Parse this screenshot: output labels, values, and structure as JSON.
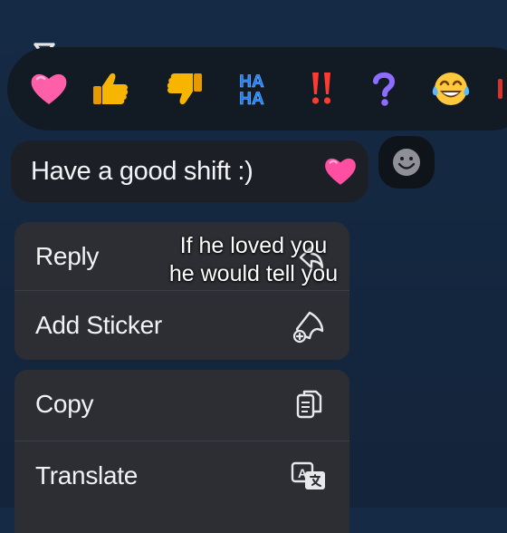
{
  "reactions": [
    {
      "name": "heart",
      "label": ""
    },
    {
      "name": "thumbs-up",
      "label": ""
    },
    {
      "name": "thumbs-down",
      "label": ""
    },
    {
      "name": "haha",
      "label": "HA HA"
    },
    {
      "name": "exclamation",
      "label": "!!"
    },
    {
      "name": "question",
      "label": "?"
    },
    {
      "name": "tears-of-joy",
      "label": ""
    }
  ],
  "message": {
    "text": "Have a good shift :)",
    "emoji": "heart"
  },
  "menu": {
    "reply": "Reply",
    "add_sticker": "Add Sticker",
    "copy": "Copy",
    "translate": "Translate"
  },
  "caption": {
    "line1": "If he loved you",
    "line2": "he would tell you"
  },
  "colors": {
    "background": "#152a45",
    "bar": "#121a24",
    "bubble": "#1c1f26",
    "menu": "#2c2e34",
    "heart": "#ff5fa8",
    "thumb": "#f7b500",
    "haha_blue": "#1b7cff",
    "exclaim_red": "#ff3b30",
    "question_purple": "#8d6cff"
  }
}
